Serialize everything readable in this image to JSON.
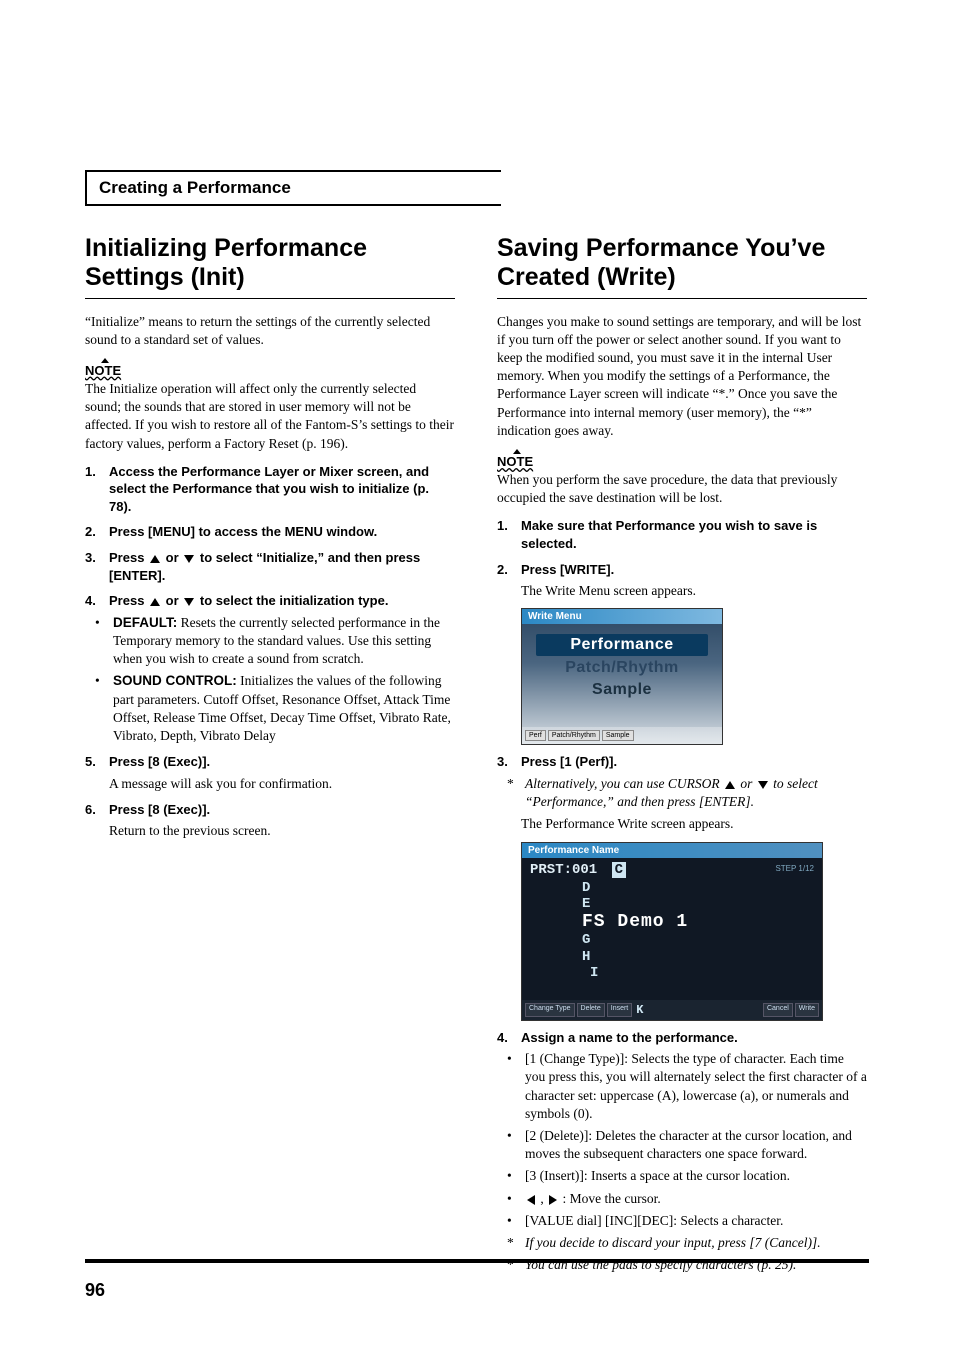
{
  "page_number": "96",
  "header": "Creating a Performance",
  "left": {
    "h1": "Initializing Performance Settings (Init)",
    "intro": "“Initialize” means to return the settings of the currently selected sound to a standard set of values.",
    "note_label": "NOTE",
    "note_body": "The Initialize operation will affect only the currently selected sound; the sounds that are stored in user memory will not be affected. If you wish to restore all of the Fantom-S’s settings to their factory values, perform a Factory Reset (p. 196).",
    "steps": {
      "1": "Access the Performance Layer or Mixer screen, and select the Performance that you wish to initialize (p. 78).",
      "2": "Press [MENU] to access the MENU window.",
      "3a": "Press ",
      "3b": " or ",
      "3c": " to select “Initialize,” and then press [ENTER].",
      "4a": "Press ",
      "4b": " or ",
      "4c": " to select the initialization type.",
      "5": "Press [8 (Exec)].",
      "6": "Press [8 (Exec)]."
    },
    "bullets": {
      "default_label": "DEFAULT:",
      "default_text": " Resets the currently selected performance in the Temporary memory to the standard values. Use this setting when you wish to create a sound from scratch.",
      "sound_label": "SOUND CONTROL:",
      "sound_text": " Initializes the values of the following part parameters. Cutoff Offset, Resonance Offset, Attack Time Offset, Release Time Offset, Decay Time Offset, Vibrato Rate, Vibrato, Depth, Vibrato Delay"
    },
    "sub5": "A message will ask you for confirmation.",
    "sub6": "Return to the previous screen."
  },
  "right": {
    "h1": "Saving Performance You’ve Created (Write)",
    "intro": "Changes you make to sound settings are temporary, and will be lost if you turn off the power or select another sound. If you want to keep the modified sound, you must save it in the internal User memory. When you modify the settings of a Performance, the Performance Layer screen will indicate “*.” Once you save the Performance into internal memory (user memory), the “*” indication goes away.",
    "note_label": "NOTE",
    "note_body": "When you perform the save procedure, the data that previously occupied the save destination will be lost.",
    "steps": {
      "1": "Make sure that Performance you wish to save is selected.",
      "2": "Press [WRITE].",
      "3": "Press [1 (Perf)].",
      "4": "Assign a name to the performance."
    },
    "sub2": "The Write Menu screen appears.",
    "star3a": "Alternatively, you can use CURSOR ",
    "star3b": " or ",
    "star3c": " to select “Performance,” and then press [ENTER].",
    "sub3": "The Performance Write screen appears.",
    "bullets4": {
      "b1": "[1 (Change Type)]: Selects the type of character. Each time you press this, you will alternately select the first character of a character set: uppercase (A), lowercase (a), or numerals and symbols (0).",
      "b2": "[2 (Delete)]: Deletes the character at the cursor location, and moves the subsequent characters one space forward.",
      "b3": "[3 (Insert)]: Inserts a space at the cursor location.",
      "b4": " : Move the cursor.",
      "b5": "[VALUE dial] [INC][DEC]: Selects a character."
    },
    "stars_end": {
      "s1": "If you decide to discard your input, press [7 (Cancel)].",
      "s2": "You can use the pads to specify characters (p. 25)."
    },
    "shot1": {
      "title": "Write Menu",
      "item1": "Performance",
      "item2": "Patch/Rhythm",
      "item3": "Sample",
      "a1": "Perf",
      "a2": "Patch/Rhythm",
      "a3": "Sample"
    },
    "shot2": {
      "title": "Performance Name",
      "prst": "PRST:001",
      "cursor_c": "C",
      "step": "STEP 1/12",
      "l_d": "D",
      "l_e": "E",
      "l_big": "FS Demo 1",
      "l_g": "G",
      "l_h": "H",
      "l_i": "I",
      "l_k": "K",
      "a1": "Change Type",
      "a2": "Delete",
      "a3": "Insert",
      "a4": "Cancel",
      "a5": "Write"
    }
  }
}
